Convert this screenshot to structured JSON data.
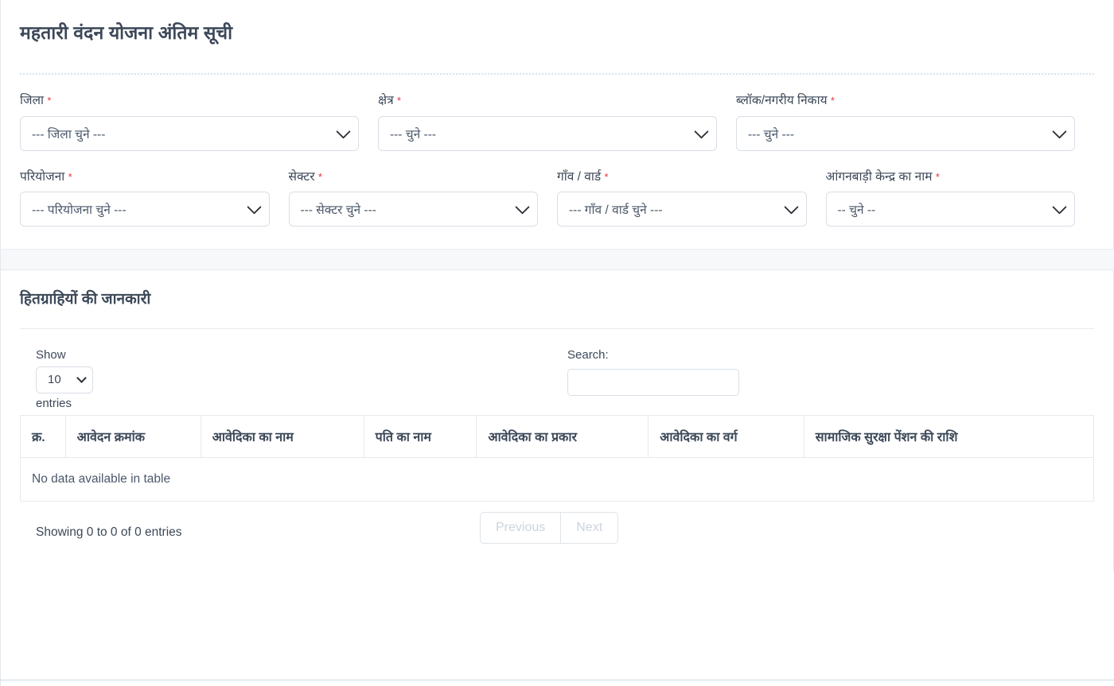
{
  "header": {
    "title": "महतारी वंदन योजना अंतिम सूची"
  },
  "filters": {
    "row1": [
      {
        "label": "जिला",
        "required": "*",
        "value": "--- जिला चुने ---"
      },
      {
        "label": "क्षेत्र",
        "required": "*",
        "value": "--- चुने ---"
      },
      {
        "label": "ब्लॉक/नगरीय निकाय",
        "required": "*",
        "value": "--- चुने ---"
      }
    ],
    "row2": [
      {
        "label": "परियोजना",
        "required": "*",
        "value": "--- परियोजना चुने ---"
      },
      {
        "label": "सेक्टर",
        "required": "*",
        "value": "--- सेक्टर चुने ---"
      },
      {
        "label": "गाँव / वार्ड",
        "required": "*",
        "value": "--- गाँव / वार्ड चुने ---"
      },
      {
        "label": "आंगनबाड़ी केन्द्र का नाम",
        "required": "*",
        "value": "-- चुने --"
      }
    ]
  },
  "beneficiaries": {
    "section_title": "हितग्राहियों की जानकारी",
    "datatable": {
      "show_label": "Show",
      "entries_label": "entries",
      "page_length": "10",
      "search_label": "Search:",
      "search_value": "",
      "search_placeholder": "",
      "columns": [
        "क्र.",
        "आवेदन क्रमांक",
        "आवेदिका का नाम",
        "पति का नाम",
        "आवेदिका का प्रकार",
        "आवेदिका का वर्ग",
        "सामाजिक सुरक्षा पेंशन की राशि"
      ],
      "empty_message": "No data available in table",
      "info": "Showing 0 to 0 of 0 entries",
      "previous_label": "Previous",
      "next_label": "Next"
    }
  },
  "colors": {
    "text": "#3c4858",
    "required": "#e8343a",
    "border": "#e6eaee",
    "disabled": "#ccd4de"
  }
}
